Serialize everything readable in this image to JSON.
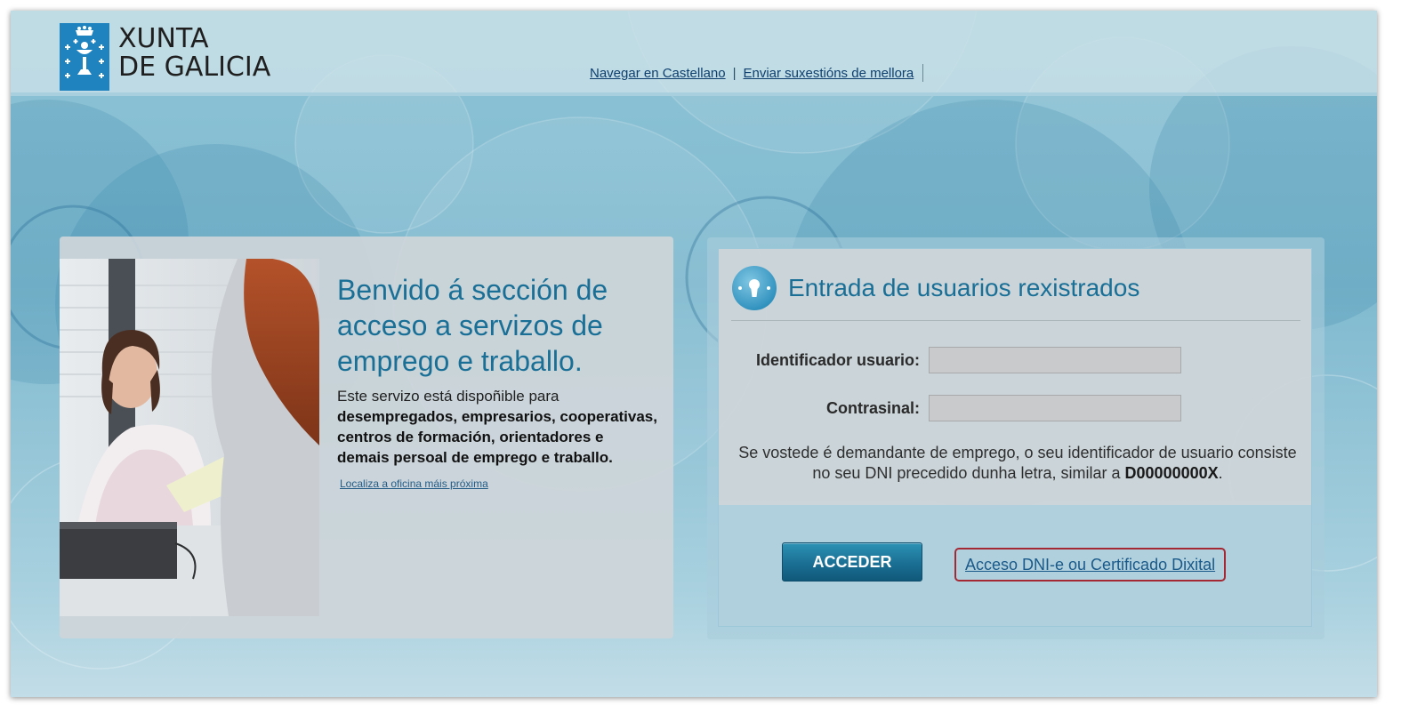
{
  "header": {
    "logo": {
      "line1": "XUNTA",
      "line2": "DE GALICIA"
    },
    "links": {
      "castellano": "Navegar en Castellano",
      "separator": "|",
      "suggestions": "Enviar suxestións de mellora"
    }
  },
  "welcome": {
    "title": "Benvido á sección de acceso a servizos de emprego e traballo.",
    "intro": "Este servizo está dispoñible para",
    "audience": "desempregados, empresarios, cooperativas, centros de formación, orientadores e demais persoal de emprego e traballo.",
    "office_link": "Localiza a oficina máis próxima"
  },
  "login": {
    "title": "Entrada de usuarios rexistrados",
    "user_label": "Identificador usuario:",
    "user_value": "",
    "password_label": "Contrasinal:",
    "password_value": "",
    "hint_prefix": "Se vostede é demandante de emprego, o seu identificador de usuario consiste no seu DNI precedido dunha letra, similar a ",
    "hint_example": "D00000000X",
    "hint_suffix": ".",
    "submit_label": "ACCEDER",
    "dni_link": "Acceso DNI-e ou Certificado Dixital"
  },
  "colors": {
    "accent_blue": "#1a6f96",
    "button_blue": "#1a6f93",
    "highlight_red": "#a42834"
  },
  "icons": {
    "emblem": "xunta-emblem-icon",
    "key": "keyhole-icon"
  }
}
